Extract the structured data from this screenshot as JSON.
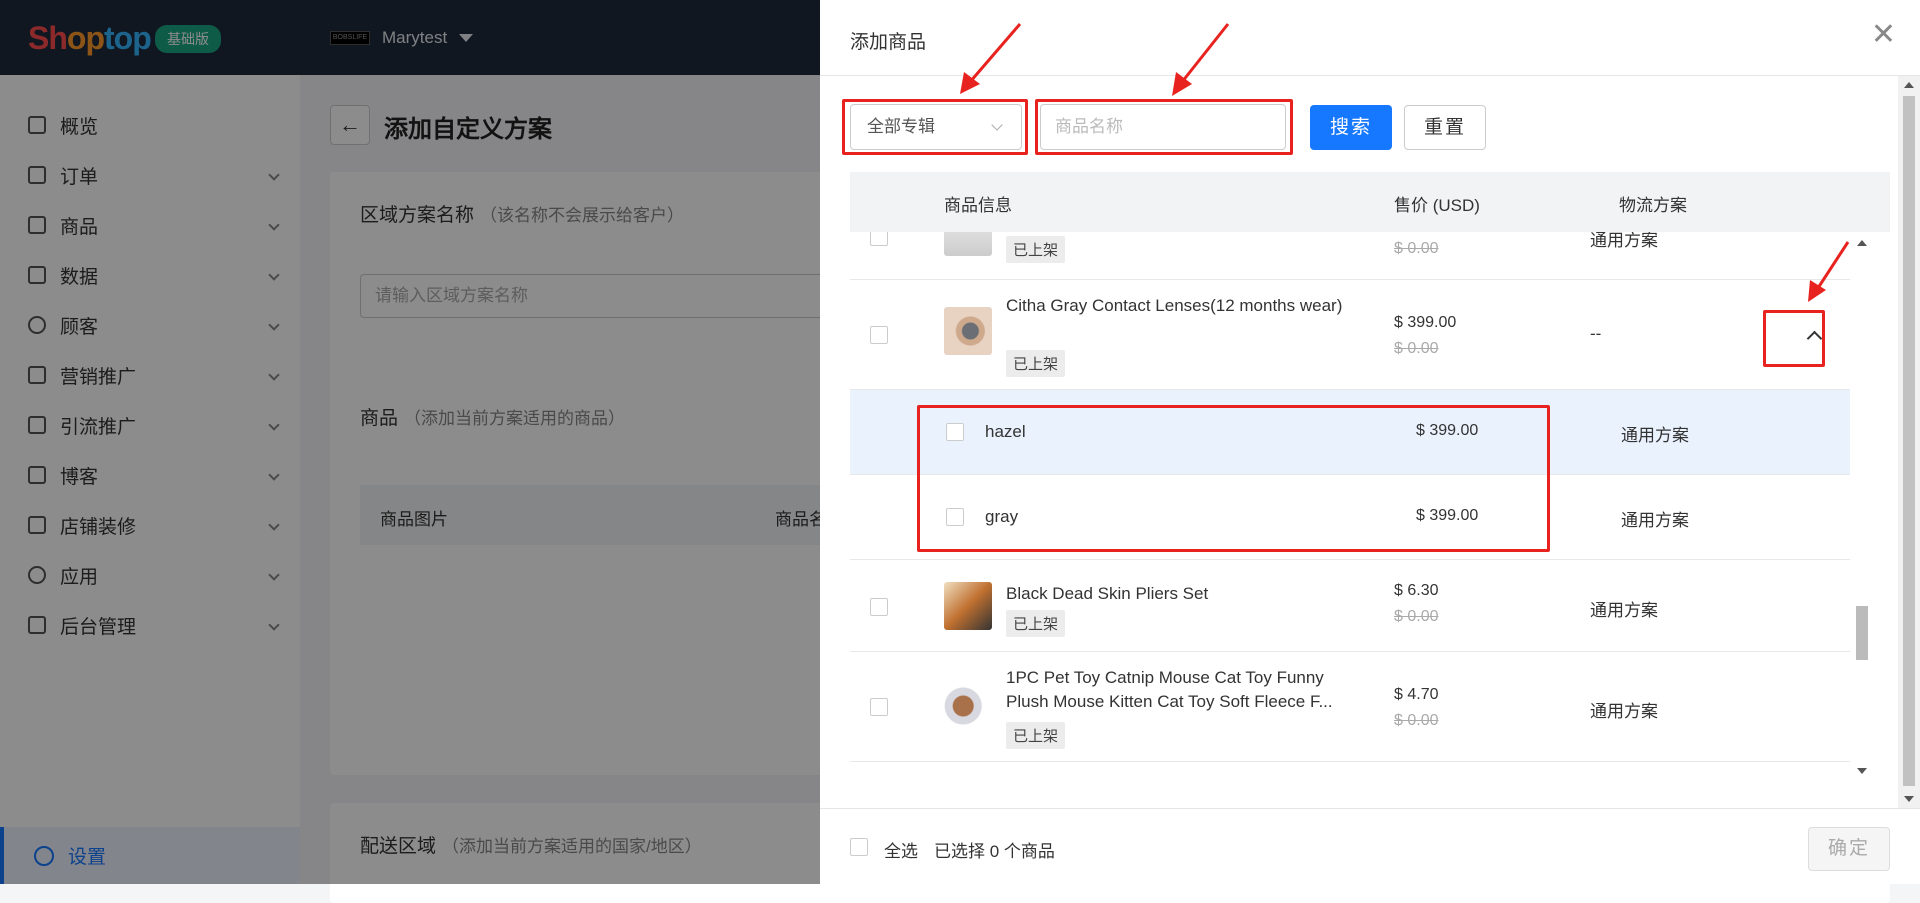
{
  "topbar": {
    "logo_part1": "Sh",
    "logo_part2": "op",
    "logo_part3": "top",
    "edition": "基础版",
    "store_name": "Marytest",
    "store_logo_text": "BOBSLIFE"
  },
  "sidebar": {
    "items": [
      {
        "label": "概览",
        "icon": "overview-icon"
      },
      {
        "label": "订单",
        "icon": "order-icon"
      },
      {
        "label": "商品",
        "icon": "product-icon"
      },
      {
        "label": "数据",
        "icon": "data-icon"
      },
      {
        "label": "顾客",
        "icon": "customer-icon"
      },
      {
        "label": "营销推广",
        "icon": "tag-icon"
      },
      {
        "label": "引流推广",
        "icon": "traffic-icon"
      },
      {
        "label": "博客",
        "icon": "blog-icon"
      },
      {
        "label": "店铺装修",
        "icon": "store-design-icon"
      },
      {
        "label": "应用",
        "icon": "app-icon"
      },
      {
        "label": "后台管理",
        "icon": "folder-icon"
      }
    ],
    "settings_label": "设置"
  },
  "main": {
    "page_title": "添加自定义方案",
    "region_name_title": "区域方案名称",
    "region_name_hint": "（该名称不会展示给客户）",
    "region_name_placeholder": "请输入区域方案名称",
    "products_title": "商品",
    "products_hint": "（添加当前方案适用的商品）",
    "col_product_image": "商品图片",
    "col_product_name": "商品名",
    "delivery_title": "配送区域",
    "delivery_hint": "（添加当前方案适用的国家/地区）"
  },
  "drawer": {
    "title": "添加商品",
    "filter_select": "全部专辑",
    "search_placeholder": "商品名称",
    "search_button": "搜索",
    "reset_button": "重置",
    "columns": {
      "info": "商品信息",
      "price": "售价 (USD)",
      "shipping": "物流方案"
    },
    "rows": [
      {
        "name": "",
        "status": "已上架",
        "price": "",
        "old_price": "$ 0.00",
        "shipping": "通用方案"
      },
      {
        "name": "Citha Gray Contact Lenses(12 months wear)",
        "status": "已上架",
        "price": "$ 399.00",
        "old_price": "$ 0.00",
        "shipping": "--"
      },
      {
        "name": "Black Dead Skin Pliers Set",
        "status": "已上架",
        "price": "$ 6.30",
        "old_price": "$ 0.00",
        "shipping": "通用方案"
      },
      {
        "name": "1PC Pet Toy Catnip Mouse Cat Toy Funny Plush Mouse Kitten Cat Toy Soft Fleece F...",
        "status": "已上架",
        "price": "$ 4.70",
        "old_price": "$ 0.00",
        "shipping": "通用方案"
      }
    ],
    "variants": [
      {
        "name": "hazel",
        "price": "$ 399.00",
        "shipping": "通用方案"
      },
      {
        "name": "gray",
        "price": "$ 399.00",
        "shipping": "通用方案"
      }
    ],
    "footer": {
      "select_all": "全选",
      "selected_count": "已选择 0 个商品",
      "confirm_button": "确定"
    }
  },
  "colors": {
    "primary": "#1677ff",
    "annotation_red": "#e8231f",
    "topbar_bg": "#1f2b3c",
    "edition_badge": "#1ba784"
  }
}
